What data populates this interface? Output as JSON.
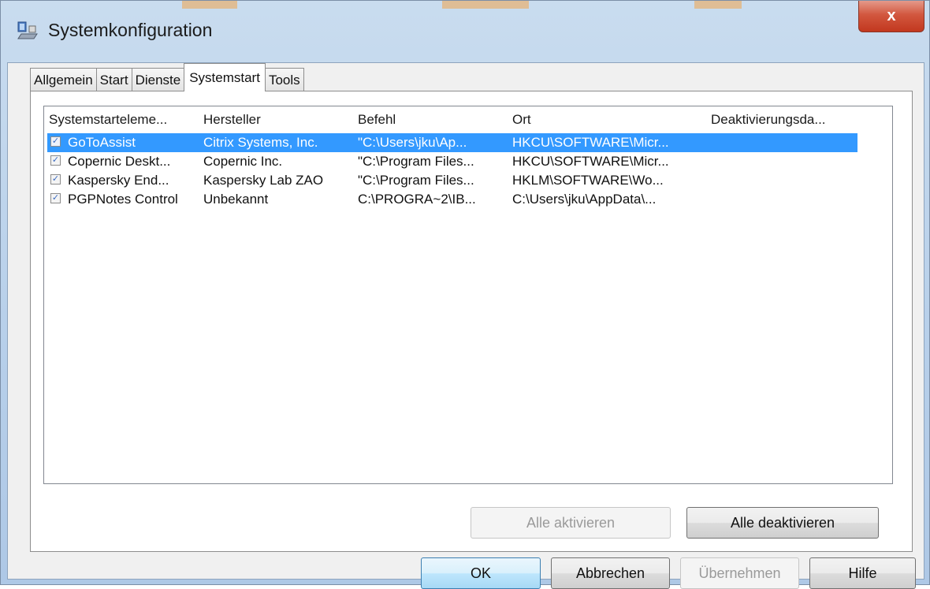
{
  "window": {
    "title": "Systemkonfiguration",
    "close_glyph": "x",
    "icon": "msconfig-icon"
  },
  "tabs": [
    {
      "label": "Allgemein",
      "active": false
    },
    {
      "label": "Start",
      "active": false
    },
    {
      "label": "Dienste",
      "active": false
    },
    {
      "label": "Systemstart",
      "active": true
    },
    {
      "label": "Tools",
      "active": false
    }
  ],
  "startup_list": {
    "columns": [
      "Systemstarteleme...",
      "Hersteller",
      "Befehl",
      "Ort",
      "Deaktivierungsda..."
    ],
    "rows": [
      {
        "checked": true,
        "selected": true,
        "name": "GoToAssist",
        "vendor": "Citrix Systems, Inc.",
        "command": "\"C:\\Users\\jku\\Ap...",
        "location": "HKCU\\SOFTWARE\\Micr...",
        "disabled_date": ""
      },
      {
        "checked": true,
        "selected": false,
        "name": "Copernic Deskt...",
        "vendor": "Copernic Inc.",
        "command": "\"C:\\Program Files...",
        "location": "HKCU\\SOFTWARE\\Micr...",
        "disabled_date": ""
      },
      {
        "checked": true,
        "selected": false,
        "name": "Kaspersky End...",
        "vendor": "Kaspersky Lab ZAO",
        "command": "\"C:\\Program Files...",
        "location": "HKLM\\SOFTWARE\\Wo...",
        "disabled_date": ""
      },
      {
        "checked": true,
        "selected": false,
        "name": "PGPNotes Control",
        "vendor": "Unbekannt",
        "command": "C:\\PROGRA~2\\IB...",
        "location": "C:\\Users\\jku\\AppData\\...",
        "disabled_date": ""
      }
    ]
  },
  "panel_buttons": {
    "enable_all": "Alle aktivieren",
    "disable_all": "Alle deaktivieren"
  },
  "dialog_buttons": {
    "ok": "OK",
    "cancel": "Abbrechen",
    "apply": "Übernehmen",
    "help": "Hilfe"
  },
  "colors": {
    "selection": "#3399ff",
    "close_button": "#c2381f",
    "title_bar": "#b8d0ea"
  }
}
